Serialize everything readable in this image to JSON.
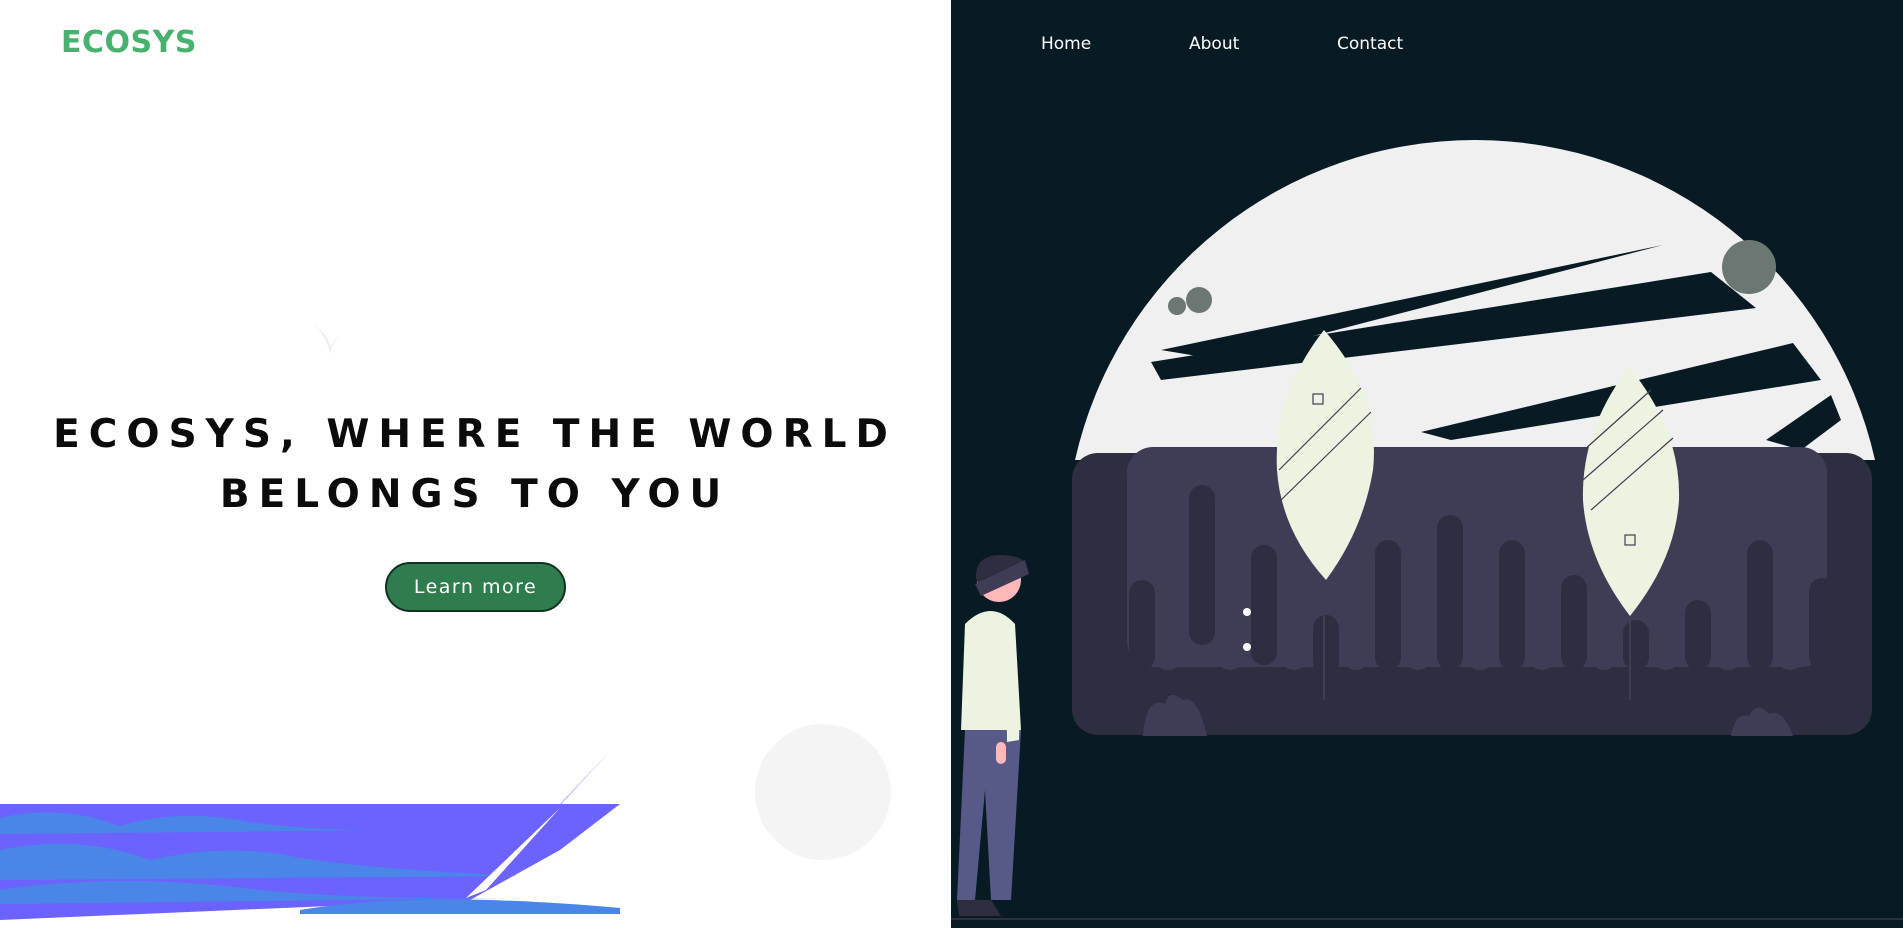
{
  "brand": {
    "logo_text": "ECOSYS",
    "logo_color": "#49b16e"
  },
  "nav": {
    "items": [
      {
        "label": "Home"
      },
      {
        "label": "About"
      },
      {
        "label": "Contact"
      }
    ]
  },
  "hero": {
    "title_line1": "ECOSYS, WHERE THE WORLD",
    "title_line2": "BELONGS TO YOU",
    "cta_label": "Learn more",
    "cta_color": "#2f7d4e"
  },
  "colors": {
    "right_background": "#081b25",
    "wave_purple": "#6c63ff",
    "wave_blue": "#4a86e8",
    "leaf": "#ecf3e1",
    "bar_dark": "#2f2e41",
    "bar_light": "#3f3d56",
    "moon": "#f0f0f0"
  }
}
